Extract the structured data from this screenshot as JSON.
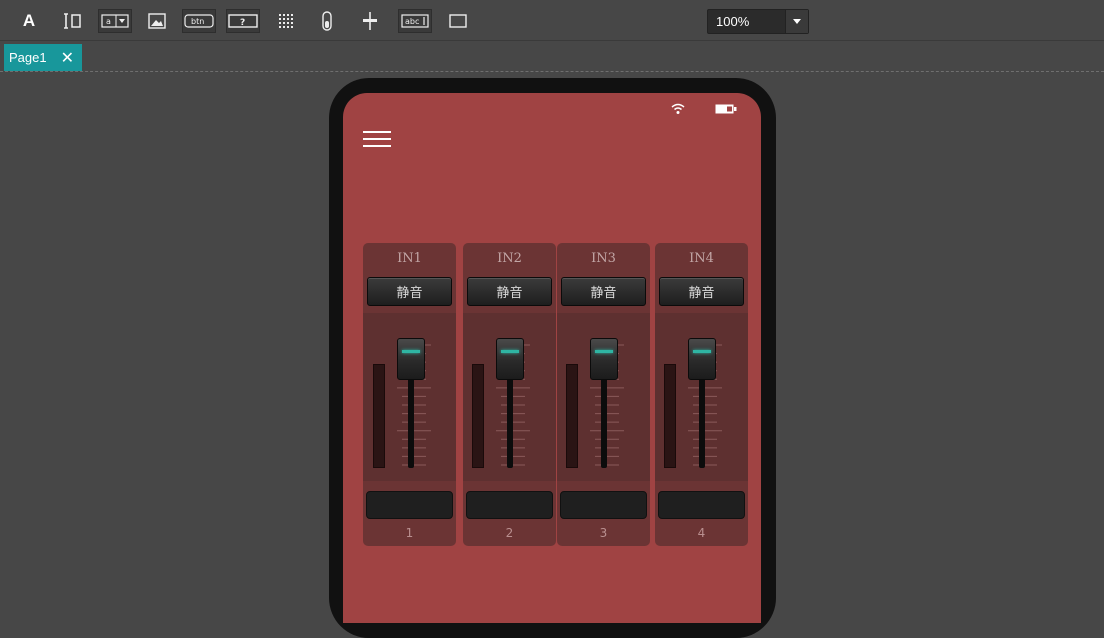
{
  "toolbar": {
    "tools": [
      {
        "icon": "text-tool-icon",
        "glyph": "A"
      },
      {
        "icon": "text-cursor-tool-icon"
      },
      {
        "icon": "dropdown-tool-icon"
      },
      {
        "icon": "image-tool-icon"
      },
      {
        "icon": "button-tool-icon",
        "glyph": "btn"
      },
      {
        "icon": "help-tool-icon",
        "glyph": "?"
      },
      {
        "icon": "grid-tool-icon"
      },
      {
        "icon": "toggle-tool-icon"
      },
      {
        "icon": "slider-tool-icon"
      },
      {
        "icon": "label-tool-icon",
        "glyph": "abc"
      },
      {
        "icon": "rectangle-tool-icon"
      }
    ],
    "zoom": "100%"
  },
  "tabs": [
    {
      "label": "Page1",
      "close_icon": "close-icon",
      "active": true
    }
  ],
  "device": {
    "status_icons": [
      "wifi-icon",
      "battery-icon"
    ],
    "menu_icon": "hamburger-menu-icon",
    "background_color": "#a04343",
    "accent_color": "#2fb5a3",
    "channels": [
      {
        "name": "IN1",
        "mute_label": "静音",
        "number": "1",
        "fader_level": 1.0
      },
      {
        "name": "IN2",
        "mute_label": "静音",
        "number": "2",
        "fader_level": 1.0
      },
      {
        "name": "IN3",
        "mute_label": "静音",
        "number": "3",
        "fader_level": 1.0
      },
      {
        "name": "IN4",
        "mute_label": "静音",
        "number": "4",
        "fader_level": 1.0
      }
    ]
  }
}
